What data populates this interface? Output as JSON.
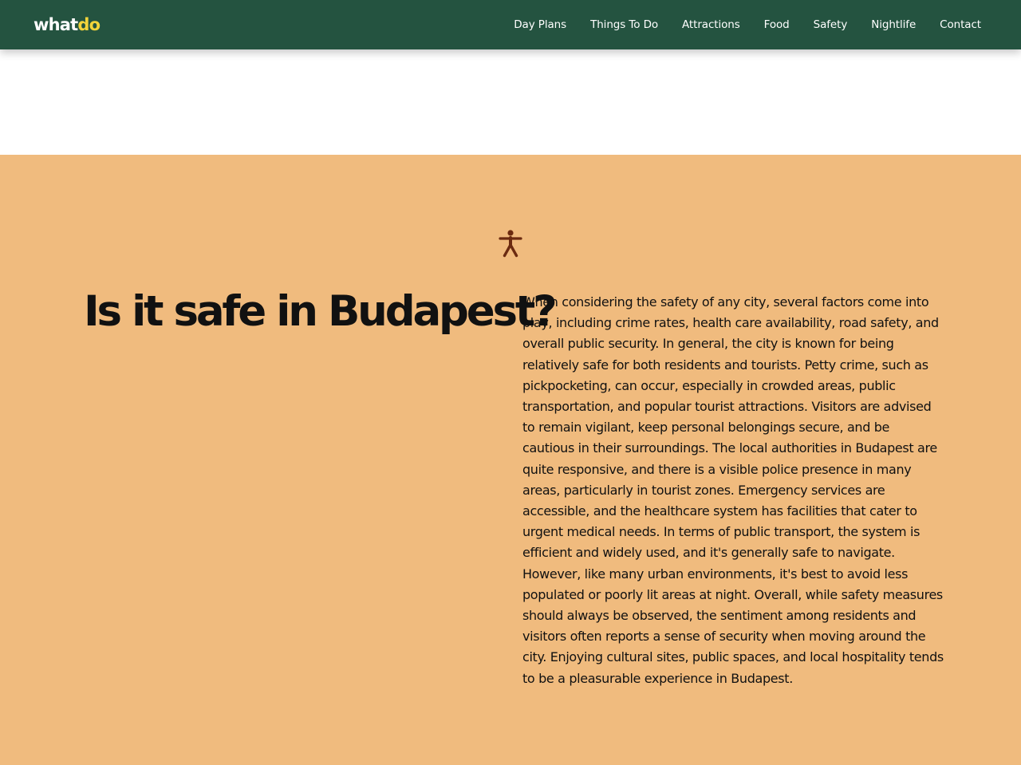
{
  "header": {
    "logo": {
      "part1": "what",
      "part2": "do"
    },
    "nav": [
      {
        "label": "Day Plans"
      },
      {
        "label": "Things To Do"
      },
      {
        "label": "Attractions"
      },
      {
        "label": "Food"
      },
      {
        "label": "Safety"
      },
      {
        "label": "Nightlife"
      },
      {
        "label": "Contact"
      }
    ]
  },
  "safety": {
    "icon": "accessibility-person-icon",
    "title": "Is it safe in Budapest?",
    "body": "When considering the safety of any city, several factors come into play, including crime rates, health care availability, road safety, and overall public security. In general, the city is known for being relatively safe for both residents and tourists. Petty crime, such as pickpocketing, can occur, especially in crowded areas, public transportation, and popular tourist attractions. Visitors are advised to remain vigilant, keep personal belongings secure, and be cautious in their surroundings. The local authorities in Budapest are quite responsive, and there is a visible police presence in many areas, particularly in tourist zones. Emergency services are accessible, and the healthcare system has facilities that cater to urgent medical needs. In terms of public transport, the system is efficient and widely used, and it's generally safe to navigate. However, like many urban environments, it's best to avoid less populated or poorly lit areas at night. Overall, while safety measures should always be observed, the sentiment among residents and visitors often reports a sense of security when moving around the city. Enjoying cultural sites, public spaces, and local hospitality tends to be a pleasurable experience in Budapest."
  },
  "colors": {
    "header_bg": "#245340",
    "logo_accent": "#f2d43a",
    "section_bg": "#f0bb7e",
    "icon_color": "#6b2a10",
    "text": "#111111"
  }
}
